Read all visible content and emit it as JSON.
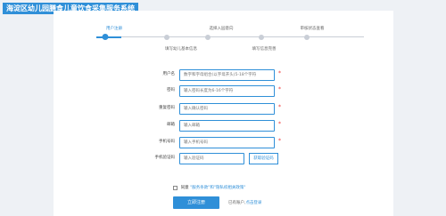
{
  "header": {
    "title": "海淀区幼儿园膳食儿童饮食采集服务系统"
  },
  "steps": [
    {
      "label": "用户注册",
      "active": true
    },
    {
      "label": "填写幼儿基本信息",
      "active": false
    },
    {
      "label": "选择入园意向",
      "active": false
    },
    {
      "label": "填写信息完善",
      "active": false
    },
    {
      "label": "审核状态查看",
      "active": false
    }
  ],
  "form": {
    "fields": [
      {
        "label": "用户名",
        "placeholder": "数字和字母组合(以字母开头)5-18个字符",
        "required": true
      },
      {
        "label": "密码",
        "placeholder": "输入密码长度为6-16个字符",
        "required": true
      },
      {
        "label": "重复密码",
        "placeholder": "输入确认密码",
        "required": true
      },
      {
        "label": "邮箱",
        "placeholder": "输入邮箱",
        "required": true
      },
      {
        "label": "手机号码",
        "placeholder": "输入手机号码",
        "required": true
      }
    ],
    "sms": {
      "label": "手机验证码",
      "placeholder": "输入验证码",
      "button": "获取验证码"
    },
    "agreement": {
      "prefix": "同意",
      "link": "\"服务条款\"和\"隐私权相关政策\""
    },
    "submit": "立即注册",
    "login_prompt": {
      "question": "已有账户,",
      "link": "点击登录"
    }
  },
  "colors": {
    "accent": "#2f8fd8",
    "required": "#ee3333",
    "inactive": "#c9ced6"
  }
}
